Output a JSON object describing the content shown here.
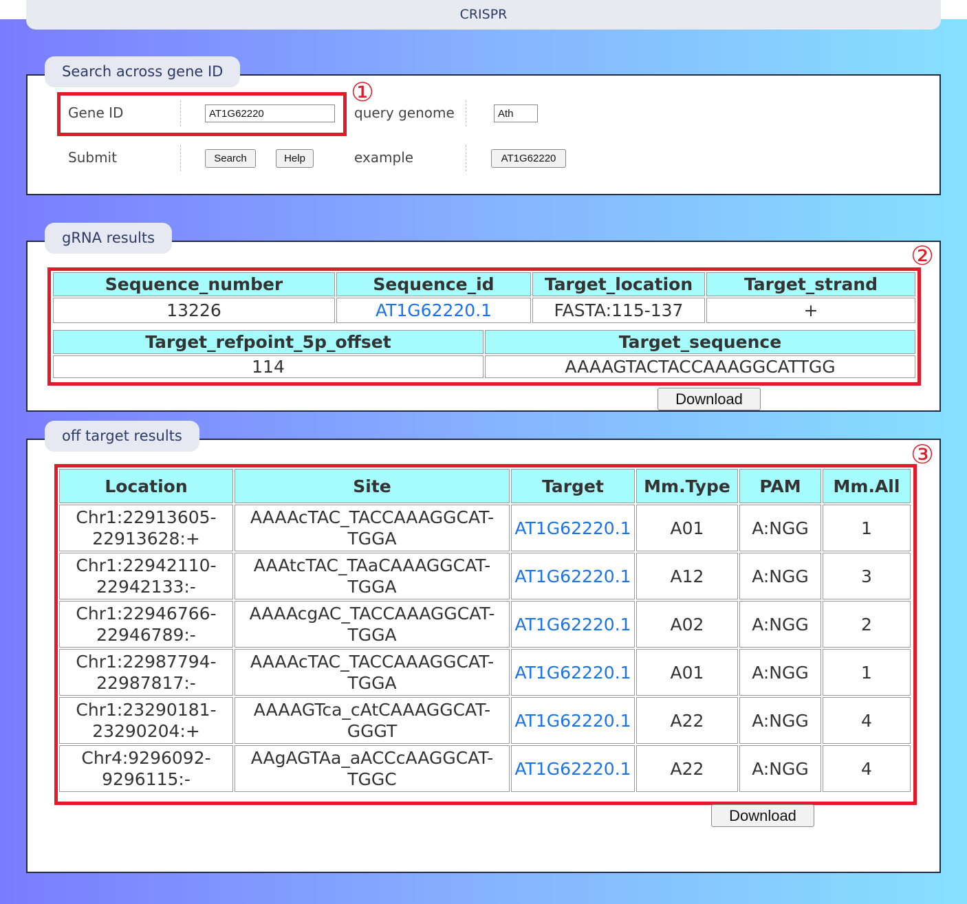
{
  "app": {
    "title": "CRISPR"
  },
  "search": {
    "legend": "Search across gene ID",
    "gene_id_label": "Gene ID",
    "gene_id_value": "AT1G62220",
    "genome_label": "query genome",
    "genome_value": "Ath",
    "submit_label": "Submit",
    "search_button": "Search",
    "help_button": "Help",
    "example_label": "example",
    "example_button": "AT1G62220"
  },
  "annotations": {
    "n1": "①",
    "n2": "②",
    "n3": "③"
  },
  "grna": {
    "legend": "gRNA results",
    "headers1": [
      "Sequence_number",
      "Sequence_id",
      "Target_location",
      "Target_strand"
    ],
    "row1": [
      "13226",
      "AT1G62220.1",
      "FASTA:115-137",
      "+"
    ],
    "headers2": [
      "Target_refpoint_5p_offset",
      "Target_sequence"
    ],
    "row2": [
      "114",
      "AAAAGTACTACCAAAGGCATTGG"
    ],
    "download": "Download"
  },
  "offtarget": {
    "legend": "off target results",
    "headers": [
      "Location",
      "Site",
      "Target",
      "Mm.Type",
      "PAM",
      "Mm.All"
    ],
    "rows": [
      [
        "Chr1:22913605-22913628:+",
        "AAAAcTAC_TACCAAAGGCAT-TGGA",
        "AT1G62220.1",
        "A01",
        "A:NGG",
        "1"
      ],
      [
        "Chr1:22942110-22942133:-",
        "AAAtcTAC_TAaCAAAGGCAT-TGGA",
        "AT1G62220.1",
        "A12",
        "A:NGG",
        "3"
      ],
      [
        "Chr1:22946766-22946789:-",
        "AAAAcgAC_TACCAAAGGCAT-TGGA",
        "AT1G62220.1",
        "A02",
        "A:NGG",
        "2"
      ],
      [
        "Chr1:22987794-22987817:-",
        "AAAAcTAC_TACCAAAGGCAT-TGGA",
        "AT1G62220.1",
        "A01",
        "A:NGG",
        "1"
      ],
      [
        "Chr1:23290181-23290204:+",
        "AAAAGTca_cAtCAAAGGCAT-GGGT",
        "AT1G62220.1",
        "A22",
        "A:NGG",
        "4"
      ],
      [
        "Chr4:9296092-9296115:-",
        "AAgAGTAa_aACCcAAGGCAT-TGGC",
        "AT1G62220.1",
        "A22",
        "A:NGG",
        "4"
      ]
    ],
    "download": "Download"
  }
}
